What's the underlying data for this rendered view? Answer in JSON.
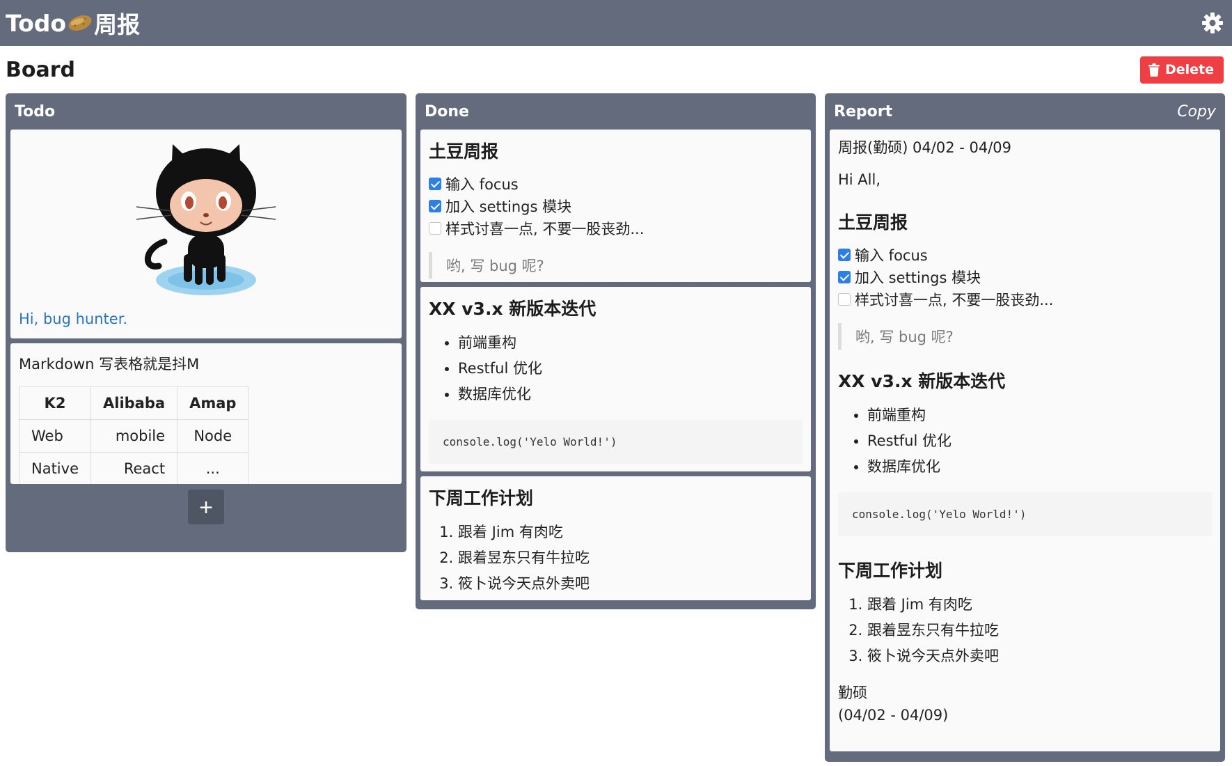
{
  "app": {
    "title_prefix": "Todo",
    "title_suffix": "周报",
    "settings_icon": "gear-icon",
    "brand_icon": "potato-icon"
  },
  "board": {
    "title": "Board",
    "delete_label": "Delete"
  },
  "colors": {
    "topbar": "#636b7c",
    "delete": "#ee3f44",
    "link": "#2a74c4",
    "checkbox": "#2d7fe5"
  },
  "columns": {
    "todo": {
      "title": "Todo",
      "image_card": {
        "caption": "Hi, bug hunter."
      },
      "table_card": {
        "title": "Markdown 写表格就是抖M",
        "headers": [
          "K2",
          "Alibaba",
          "Amap"
        ],
        "rows": [
          [
            "Web",
            "mobile",
            "Node"
          ],
          [
            "Native",
            "React",
            "..."
          ]
        ]
      },
      "add_label": "+"
    },
    "done": {
      "title": "Done",
      "card1": {
        "title": "土豆周报",
        "checks": [
          {
            "label": "输入 focus",
            "checked": true
          },
          {
            "label": "加入 settings 模块",
            "checked": true
          },
          {
            "label": "样式讨喜一点, 不要一股丧劲...",
            "checked": false
          }
        ],
        "quote": "哟, 写 bug 呢?"
      },
      "card2": {
        "title": "XX v3.x 新版本迭代",
        "bullets": [
          "前端重构",
          "Restful 优化",
          "数据库优化"
        ],
        "code": "console.log('Yelo World!')"
      },
      "card3": {
        "title": "下周工作计划",
        "items": [
          "跟着 Jim 有肉吃",
          "跟着昱东只有牛拉吃",
          "筱卜说今天点外卖吧"
        ]
      }
    },
    "report": {
      "title": "Report",
      "copy_label": "Copy",
      "heading_line": "周报(勤硕) 04/02 - 04/09",
      "greeting": "Hi All,",
      "sec1_title": "土豆周报",
      "checks": [
        {
          "label": "输入 focus",
          "checked": true
        },
        {
          "label": "加入 settings 模块",
          "checked": true
        },
        {
          "label": "样式讨喜一点, 不要一股丧劲...",
          "checked": false
        }
      ],
      "quote": "哟, 写 bug 呢?",
      "sec2_title": "XX v3.x 新版本迭代",
      "bullets": [
        "前端重构",
        "Restful 优化",
        "数据库优化"
      ],
      "code": "console.log('Yelo World!')",
      "sec3_title": "下周工作计划",
      "items": [
        "跟着 Jim 有肉吃",
        "跟着昱东只有牛拉吃",
        "筱卜说今天点外卖吧"
      ],
      "sign_name": "勤硕",
      "sign_date": "(04/02 - 04/09)"
    }
  }
}
